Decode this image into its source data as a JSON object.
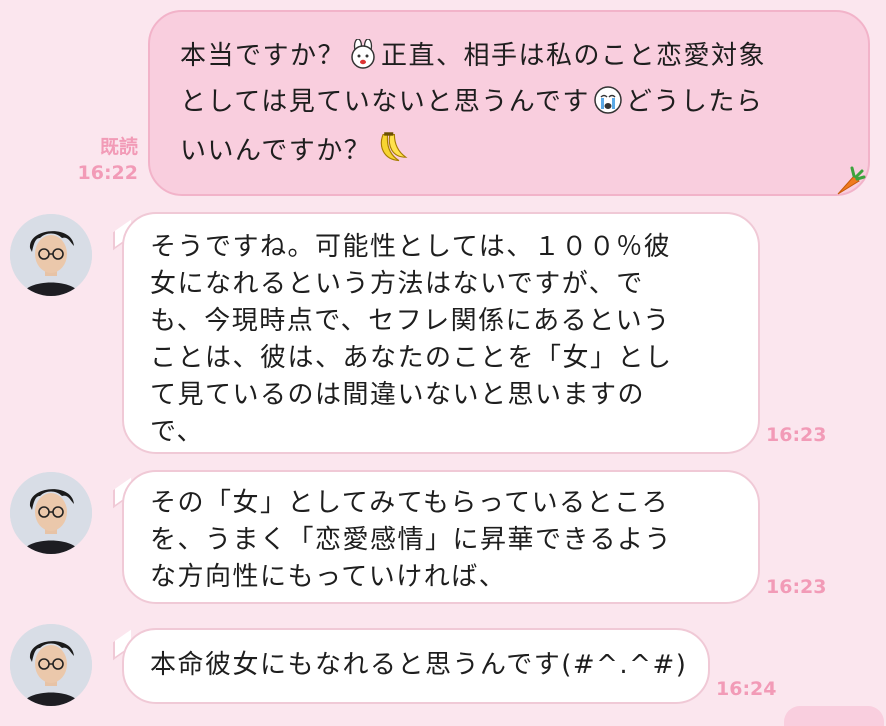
{
  "messages": {
    "outgoing": {
      "read_label": "既読",
      "time": "16:22",
      "line1_a": "本当ですか？",
      "line1_b": "正直、相手は私のこと恋愛対象",
      "line2_a": "としては見ていないと思うんです",
      "line2_b": "どうしたら",
      "line3_a": "いいんですか？"
    },
    "in1": {
      "time": "16:23",
      "lines": [
        "そうですね。可能性としては、１００％彼",
        "女になれるという方法はないですが、で",
        "も、今現時点で、セフレ関係にあるという",
        "ことは、彼は、あなたのことを「女」とし",
        "て見ているのは間違いないと思いますの",
        "で、"
      ]
    },
    "in2": {
      "time": "16:23",
      "lines": [
        "その「女」としてみてもらっているところ",
        "を、うまく「恋愛感情」に昇華できるよう",
        "な方向性にもっていければ、"
      ]
    },
    "in3": {
      "time": "16:24",
      "lines": [
        "本命彼女にもなれると思うんです(#^.^#)"
      ]
    }
  },
  "icons": {
    "rabbit": "rabbit-emoji-icon",
    "crying": "crying-emoji-icon",
    "banana": "banana-emoji-icon",
    "carrot": "carrot-icon",
    "avatar": "avatar"
  },
  "colors": {
    "background": "#fbe6ee",
    "outgoing_bubble": "#f9cede",
    "incoming_bubble": "#ffffff",
    "meta_text": "#f29bb7"
  }
}
